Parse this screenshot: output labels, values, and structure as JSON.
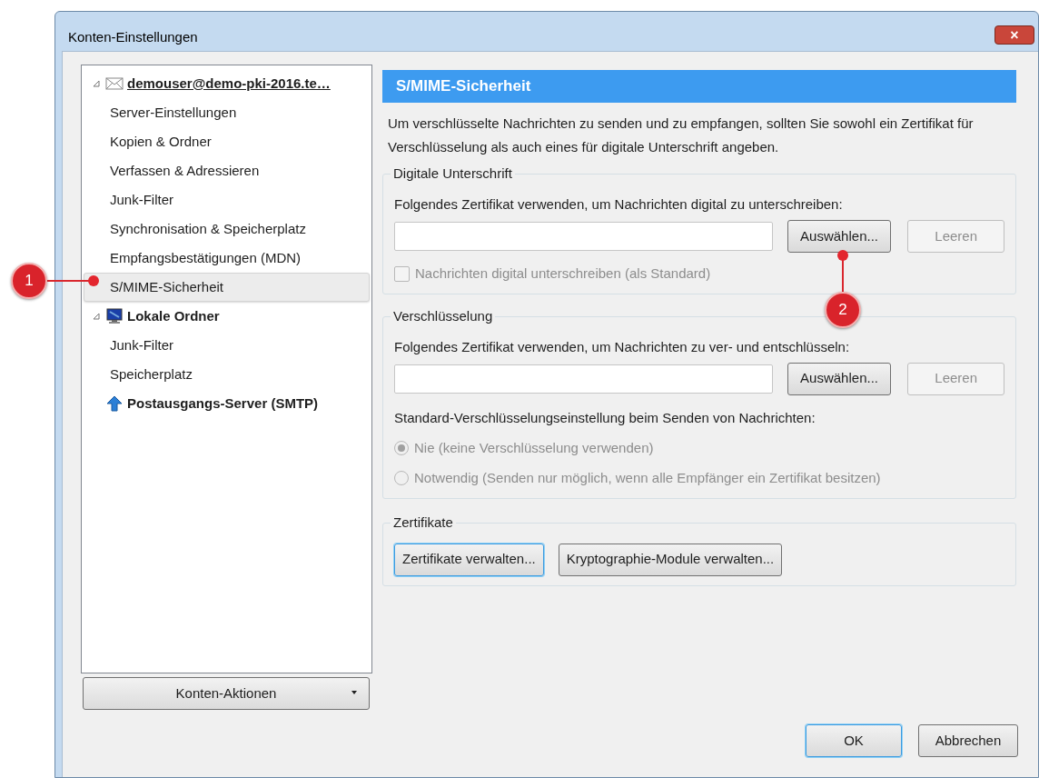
{
  "window": {
    "title": "Konten-Einstellungen",
    "close_label": "×"
  },
  "sidebar": {
    "accounts": [
      {
        "label": "demouser@demo-pki-2016.te…",
        "kind": "mail",
        "expanded": true,
        "selected": false,
        "underlined": true,
        "children": [
          {
            "label": "Server-Einstellungen",
            "selected": false
          },
          {
            "label": "Kopien & Ordner",
            "selected": false
          },
          {
            "label": "Verfassen & Adressieren",
            "selected": false
          },
          {
            "label": "Junk-Filter",
            "selected": false
          },
          {
            "label": "Synchronisation & Speicherplatz",
            "selected": false
          },
          {
            "label": "Empfangsbestätigungen (MDN)",
            "selected": false
          },
          {
            "label": "S/MIME-Sicherheit",
            "selected": true
          }
        ]
      },
      {
        "label": "Lokale Ordner",
        "kind": "local",
        "expanded": true,
        "selected": false,
        "underlined": false,
        "children": [
          {
            "label": "Junk-Filter",
            "selected": false
          },
          {
            "label": "Speicherplatz",
            "selected": false
          }
        ]
      },
      {
        "label": "Postausgangs-Server (SMTP)",
        "kind": "smtp",
        "selected": false,
        "underlined": false
      }
    ],
    "actions_button": "Konten-Aktionen"
  },
  "panel": {
    "title": "S/MIME-Sicherheit",
    "description": "Um verschlüsselte Nachrichten zu senden und zu empfangen, sollten Sie sowohl ein Zertifikat für Verschlüsselung als auch eines für digitale Unterschrift angeben.",
    "signing": {
      "legend": "Digitale Unterschrift",
      "prompt": "Folgendes Zertifikat verwenden, um Nachrichten digital zu unterschreiben:",
      "choose_button": "Auswählen...",
      "clear_button": "Leeren",
      "clear_disabled": true,
      "checkbox": {
        "label": "Nachrichten digital unterschreiben (als Standard)",
        "checked": false,
        "disabled": true
      }
    },
    "encryption": {
      "legend": "Verschlüsselung",
      "prompt": "Folgendes Zertifikat verwenden, um Nachrichten zu ver- und entschlüsseln:",
      "choose_button": "Auswählen...",
      "clear_button": "Leeren",
      "clear_disabled": true,
      "default_label": "Standard-Verschlüsselungseinstellung beim Senden von Nachrichten:",
      "options": [
        {
          "label": "Nie (keine Verschlüsselung verwenden)",
          "selected": true,
          "disabled": true
        },
        {
          "label": "Notwendig (Senden nur möglich, wenn alle Empfänger ein Zertifikat besitzen)",
          "selected": false,
          "disabled": true
        }
      ]
    },
    "certificates": {
      "legend": "Zertifikate",
      "buttons": [
        {
          "label": "Zertifikate verwalten...",
          "focused": true
        },
        {
          "label": "Kryptographie-Module verwalten...",
          "focused": false
        }
      ]
    }
  },
  "footer": {
    "buttons": [
      {
        "label": "OK",
        "default": true
      },
      {
        "label": "Abbrechen",
        "default": false
      }
    ]
  },
  "callouts": [
    {
      "label": "1"
    },
    {
      "label": "2"
    }
  ]
}
